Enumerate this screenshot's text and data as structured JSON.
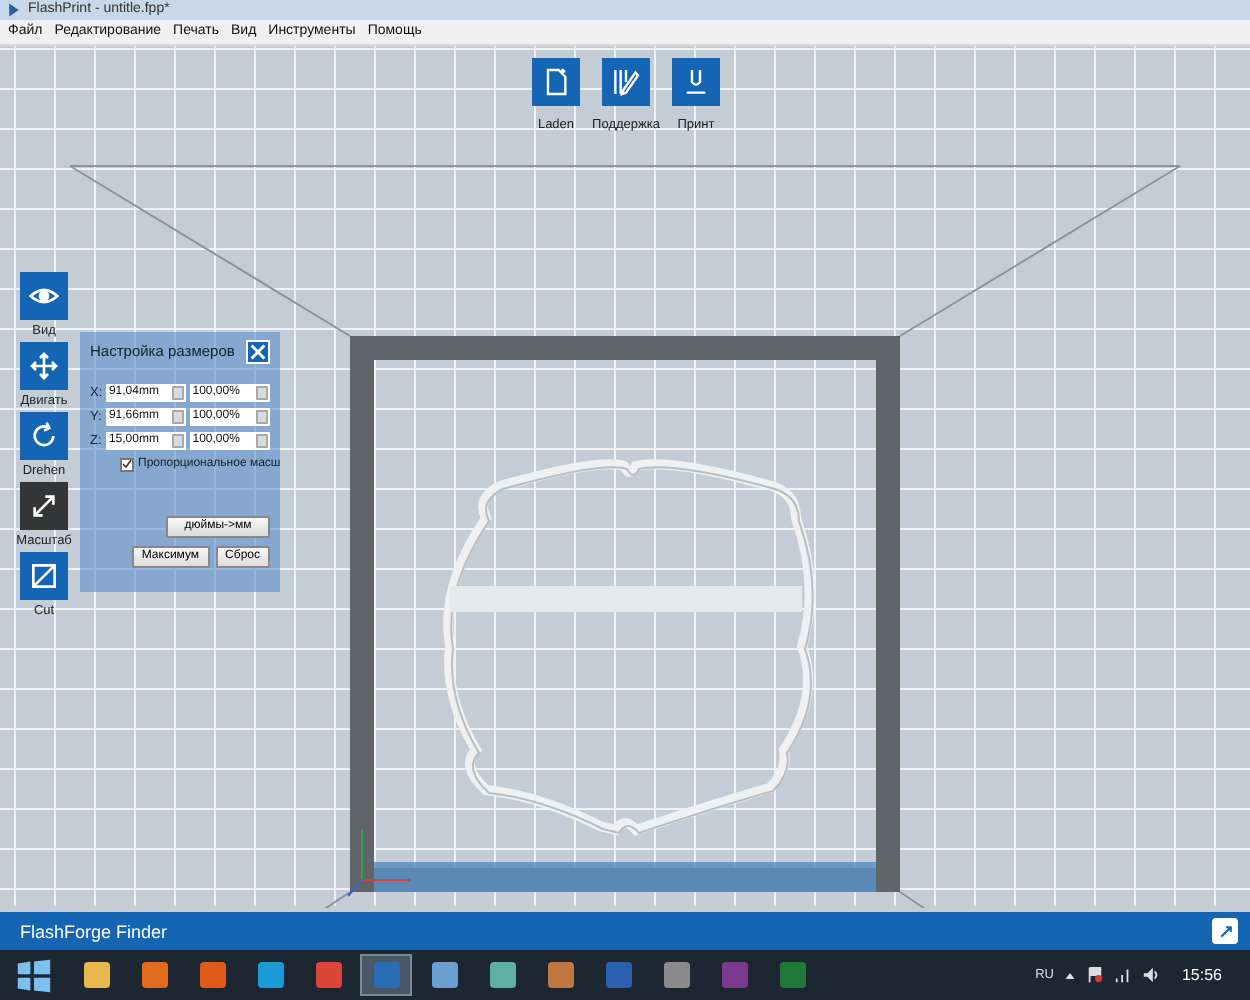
{
  "window": {
    "title": "FlashPrint - untitle.fpp*"
  },
  "menu": [
    "Файл",
    "Редактирование",
    "Печать",
    "Вид",
    "Инструменты",
    "Помощь"
  ],
  "top_toolbar": [
    {
      "kind": "load",
      "label": "Laden"
    },
    {
      "kind": "support",
      "label": "Поддержка"
    },
    {
      "kind": "print",
      "label": "Принт"
    }
  ],
  "side_tools": [
    {
      "kind": "view",
      "label": "Вид",
      "selected": false
    },
    {
      "kind": "move",
      "label": "Двигать",
      "selected": false
    },
    {
      "kind": "rotate",
      "label": "Drehen",
      "selected": false
    },
    {
      "kind": "scale",
      "label": "Масштаб",
      "selected": true
    },
    {
      "kind": "cut",
      "label": "Cut",
      "selected": false
    }
  ],
  "scale_dialog": {
    "title": "Настройка размеров",
    "rows": [
      {
        "axis": "X:",
        "size": "91,04mm",
        "percent": "100,00%"
      },
      {
        "axis": "Y:",
        "size": "91,66mm",
        "percent": "100,00%"
      },
      {
        "axis": "Z:",
        "size": "15,00mm",
        "percent": "100,00%"
      }
    ],
    "proportional": {
      "label": "Пропорциональное масш",
      "checked": true
    },
    "buttons": [
      "дюймы->мм",
      "Максимум",
      "Сброс"
    ]
  },
  "status_bar": {
    "title": "FlashForge Finder"
  },
  "taskbar": {
    "apps": [
      {
        "selected": false
      },
      {
        "selected": false
      },
      {
        "selected": false
      },
      {
        "selected": false
      },
      {
        "selected": false
      },
      {
        "selected": true
      },
      {
        "selected": false
      },
      {
        "selected": false
      },
      {
        "selected": false
      },
      {
        "selected": false
      },
      {
        "selected": false
      },
      {
        "selected": false
      },
      {
        "selected": false
      }
    ],
    "language": "RU",
    "time": "15:56"
  }
}
